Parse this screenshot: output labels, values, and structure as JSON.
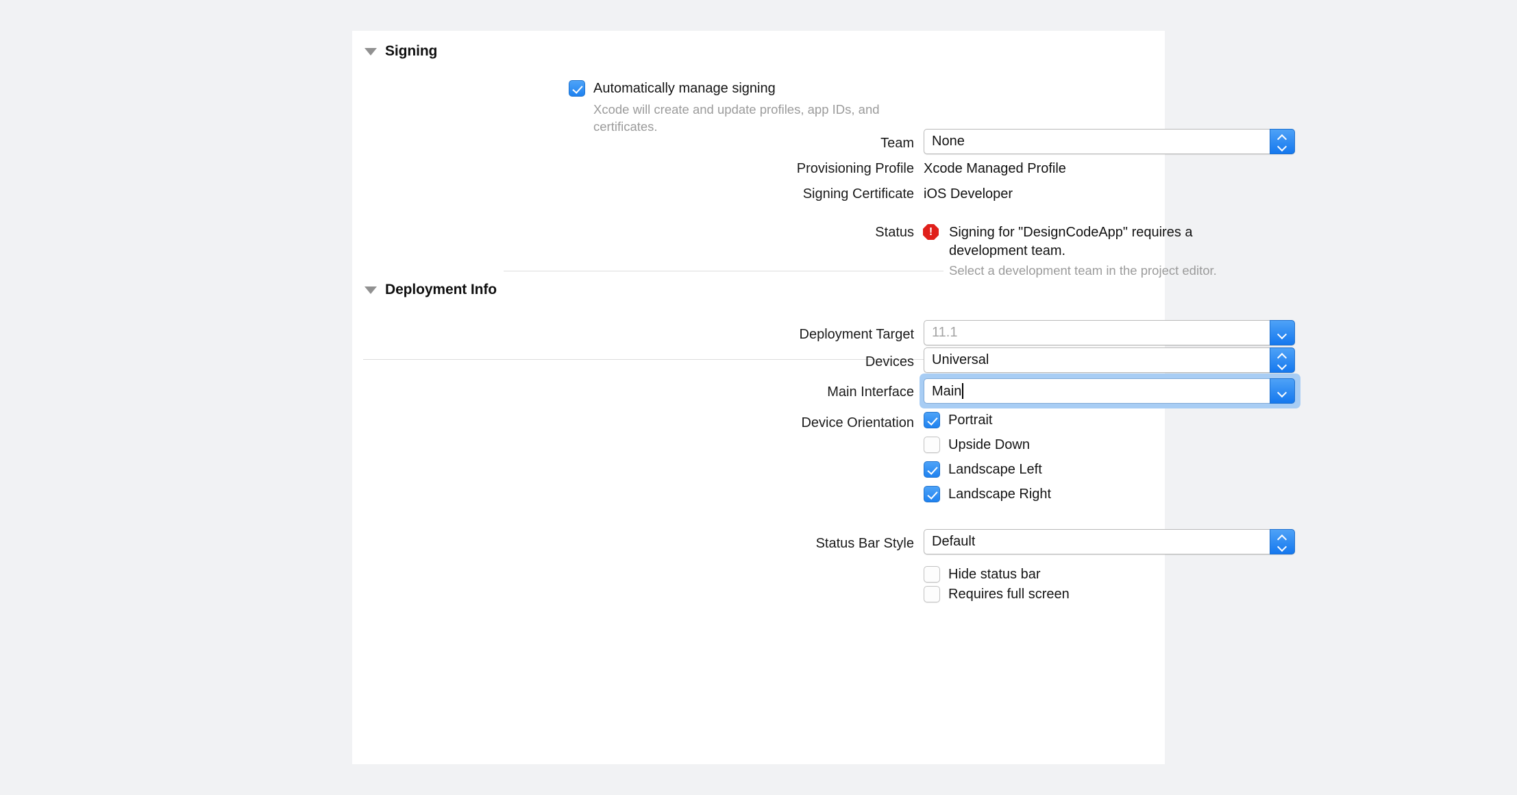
{
  "sections": {
    "signing": {
      "title": "Signing",
      "disclosure_icon": "disclosure-triangle-open-icon",
      "auto_manage": {
        "label": "Automatically manage signing",
        "checked": true,
        "helper": "Xcode will create and update profiles, app IDs, and certificates."
      },
      "team": {
        "label": "Team",
        "value": "None",
        "control": "popup-button"
      },
      "provisioning_profile": {
        "label": "Provisioning Profile",
        "value": "Xcode Managed Profile"
      },
      "signing_certificate": {
        "label": "Signing Certificate",
        "value": "iOS Developer"
      },
      "status": {
        "label": "Status",
        "icon": "error-octagon-icon",
        "message": "Signing for \"DesignCodeApp\" requires a development team.",
        "detail": "Select a development team in the project editor."
      }
    },
    "deployment_info": {
      "title": "Deployment Info",
      "disclosure_icon": "disclosure-triangle-open-icon",
      "deployment_target": {
        "label": "Deployment Target",
        "value": "11.1",
        "control": "combo-box",
        "dimmed": true
      },
      "devices": {
        "label": "Devices",
        "value": "Universal",
        "control": "popup-button"
      },
      "main_interface": {
        "label": "Main Interface",
        "value": "Main",
        "control": "combo-box",
        "focused": true
      },
      "device_orientation": {
        "label": "Device Orientation",
        "options": [
          {
            "label": "Portrait",
            "checked": true
          },
          {
            "label": "Upside Down",
            "checked": false
          },
          {
            "label": "Landscape Left",
            "checked": true
          },
          {
            "label": "Landscape Right",
            "checked": true
          }
        ]
      },
      "status_bar_style": {
        "label": "Status Bar Style",
        "value": "Default",
        "control": "popup-button"
      },
      "extra_options": [
        {
          "label": "Hide status bar",
          "checked": false
        },
        {
          "label": "Requires full screen",
          "checked": false
        }
      ]
    }
  },
  "colors": {
    "accent": "#1f82f0",
    "error": "#e0201b",
    "focus_ring": "#a8cdf4",
    "background": "#f1f2f4",
    "panel": "#ffffff"
  }
}
